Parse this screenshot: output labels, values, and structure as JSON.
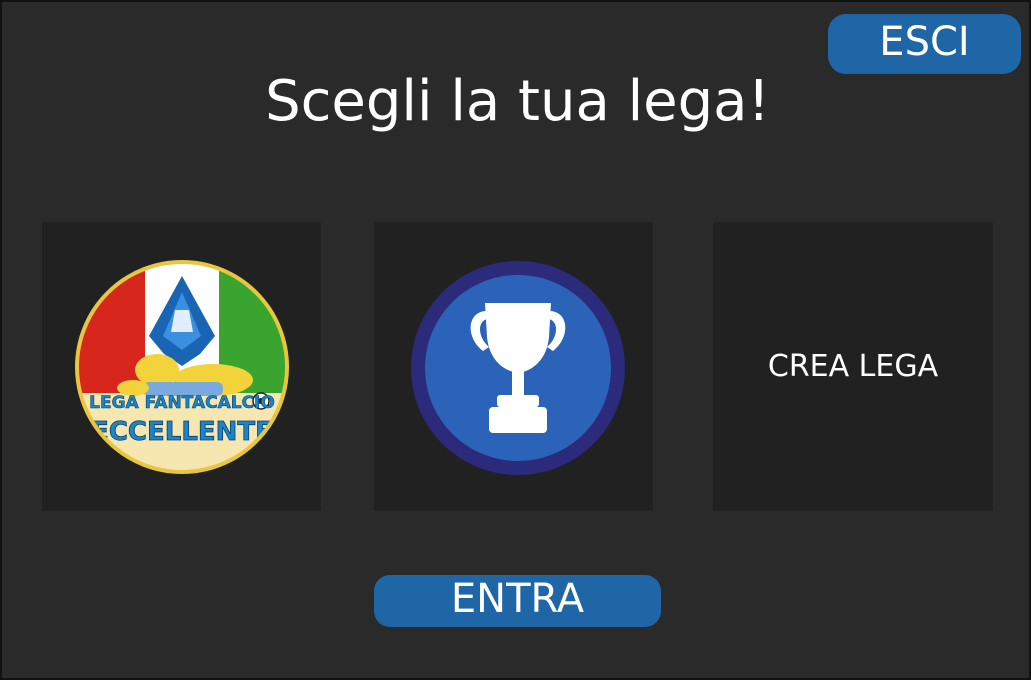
{
  "header": {
    "exit_label": "ESCI",
    "title": "Scegli la tua lega!"
  },
  "leagues": [
    {
      "kind": "league-logo",
      "logo_text_top": "LEGA FANTACALCIO",
      "logo_text_bottom": "ECCELLENTE",
      "icon": "league-crest-icon"
    },
    {
      "kind": "trophy",
      "icon": "trophy-icon"
    },
    {
      "kind": "create",
      "label": "CREA LEGA"
    }
  ],
  "footer": {
    "enter_label": "ENTRA"
  },
  "colors": {
    "background": "#2a2a2a",
    "card": "#212121",
    "button": "#1f66a6",
    "trophy_ring": "#2c2a7a",
    "trophy_fill": "#2b63b8",
    "crest_red": "#d7261b",
    "crest_green": "#3aa52e",
    "crest_blue": "#1a64b4",
    "crest_yellow": "#f3d35a"
  }
}
